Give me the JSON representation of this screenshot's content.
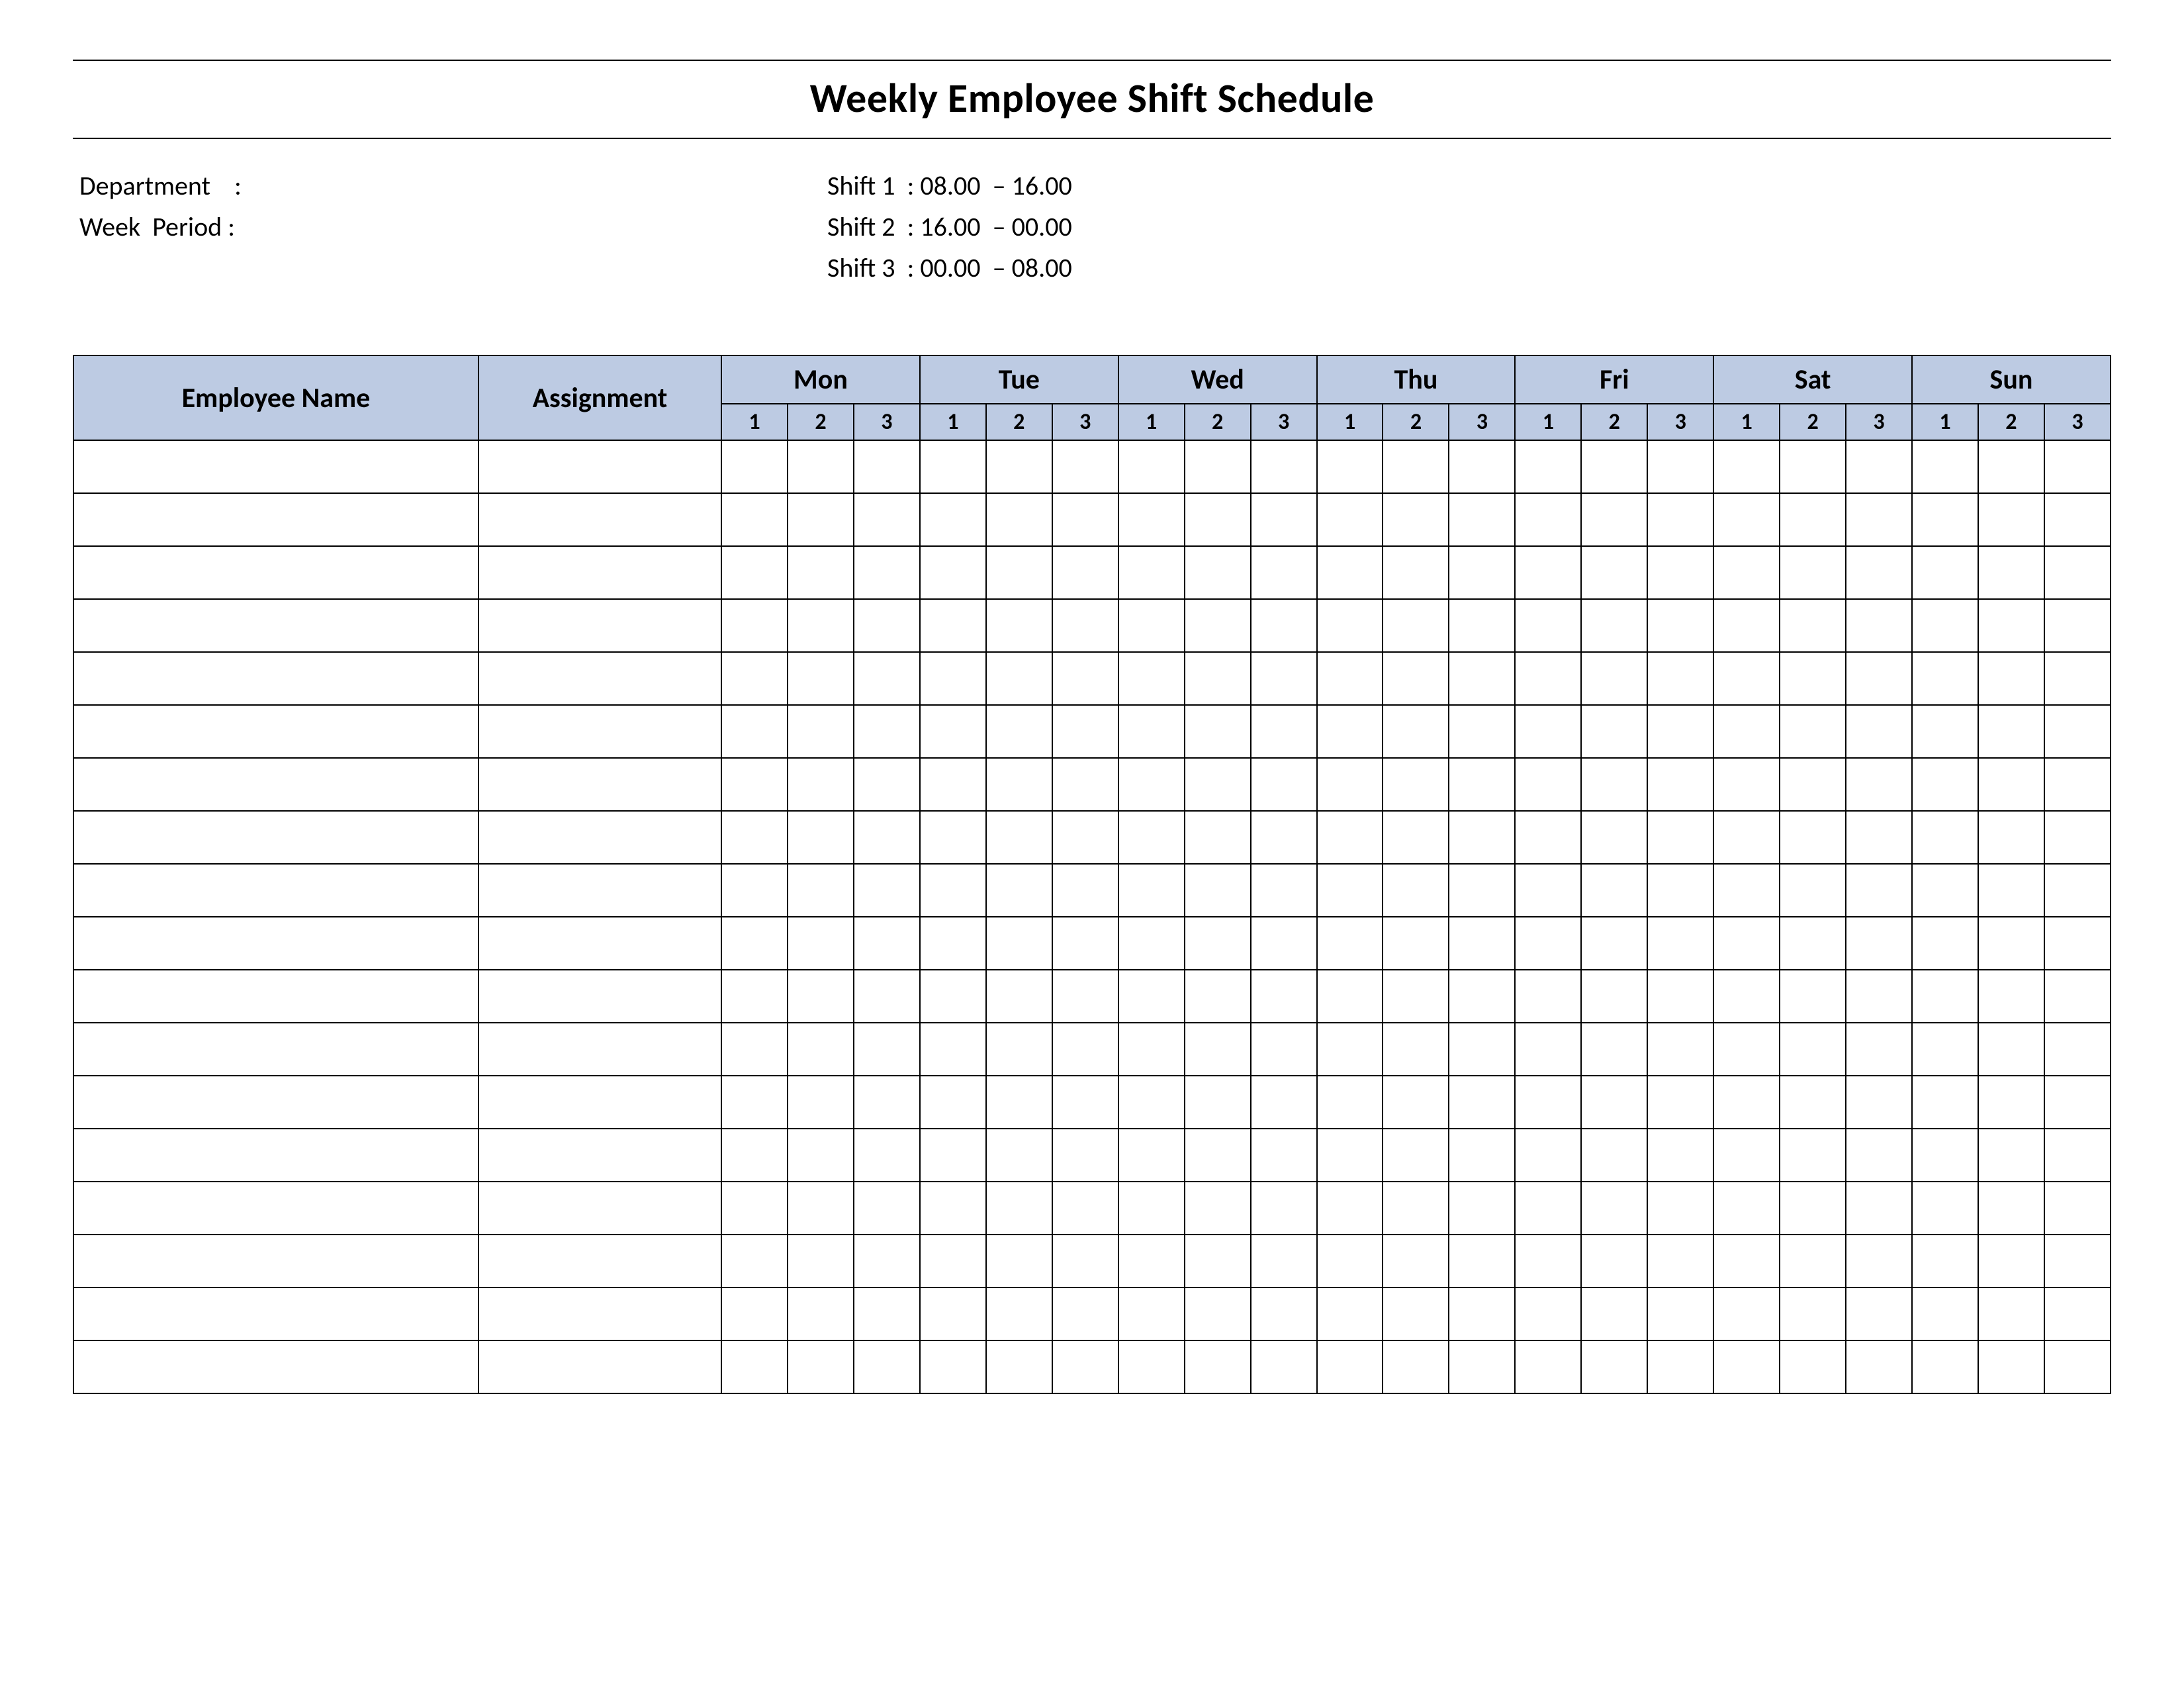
{
  "title": "Weekly Employee Shift Schedule",
  "meta": {
    "department_label": "Department    :",
    "week_period_label": "Week  Period :",
    "shift1": "Shift 1  : 08.00  – 16.00",
    "shift2": "Shift 2  : 16.00  – 00.00",
    "shift3": "Shift 3  : 00.00  – 08.00"
  },
  "table": {
    "employee_name": "Employee Name",
    "assignment": "Assignment",
    "days": [
      "Mon",
      "Tue",
      "Wed",
      "Thu",
      "Fri",
      "Sat",
      "Sun"
    ],
    "shifts": [
      "1",
      "2",
      "3"
    ],
    "row_count": 18
  }
}
